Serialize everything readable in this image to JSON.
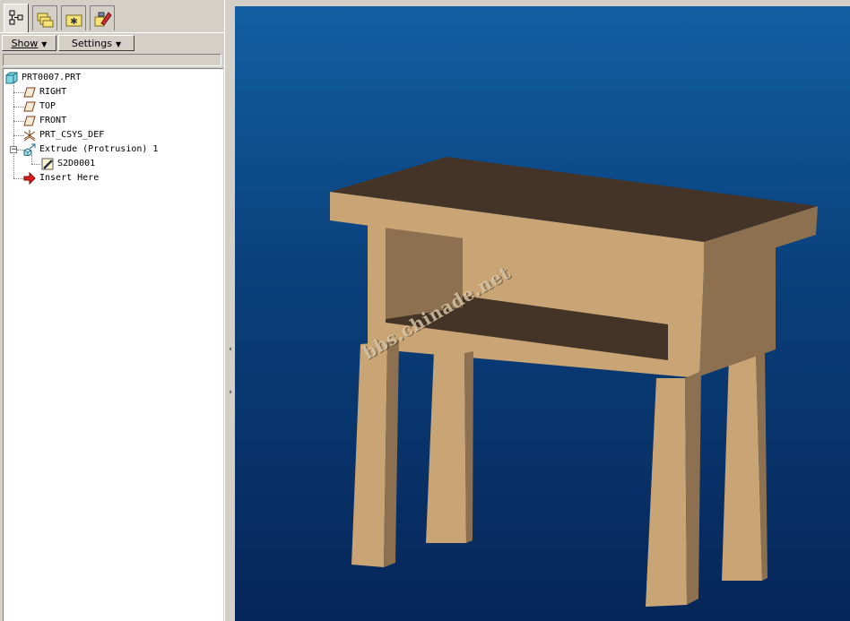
{
  "navigator": {
    "tabs": [
      {
        "name": "model-tree",
        "icon": "model-tree-icon",
        "active": true
      },
      {
        "name": "folder-browser",
        "icon": "folder-browser-icon",
        "active": false
      },
      {
        "name": "favorites",
        "icon": "favorites-icon",
        "active": false
      },
      {
        "name": "connections",
        "icon": "connections-icon",
        "active": false
      }
    ],
    "toolbar": {
      "show_label": "Show",
      "settings_label": "Settings"
    },
    "tree": {
      "root": "PRT0007.PRT",
      "items": [
        {
          "label": "RIGHT",
          "icon": "datum-plane-icon"
        },
        {
          "label": "TOP",
          "icon": "datum-plane-icon"
        },
        {
          "label": "FRONT",
          "icon": "datum-plane-icon"
        },
        {
          "label": "PRT_CSYS_DEF",
          "icon": "coordinate-system-icon"
        },
        {
          "label": "Extrude (Protrusion) 1",
          "icon": "extrude-icon",
          "expanded": true
        },
        {
          "label": "S2D0001",
          "icon": "sketch-icon"
        },
        {
          "label": "Insert Here",
          "icon": "insert-arrow-icon"
        }
      ]
    }
  },
  "viewport": {
    "watermark": "bbs.chinade.net",
    "background_top": "#115fa2",
    "background_bottom": "#062659",
    "model_top_color": "#433427",
    "model_face_color": "#c9a475",
    "model_side_color": "#8c704f"
  }
}
